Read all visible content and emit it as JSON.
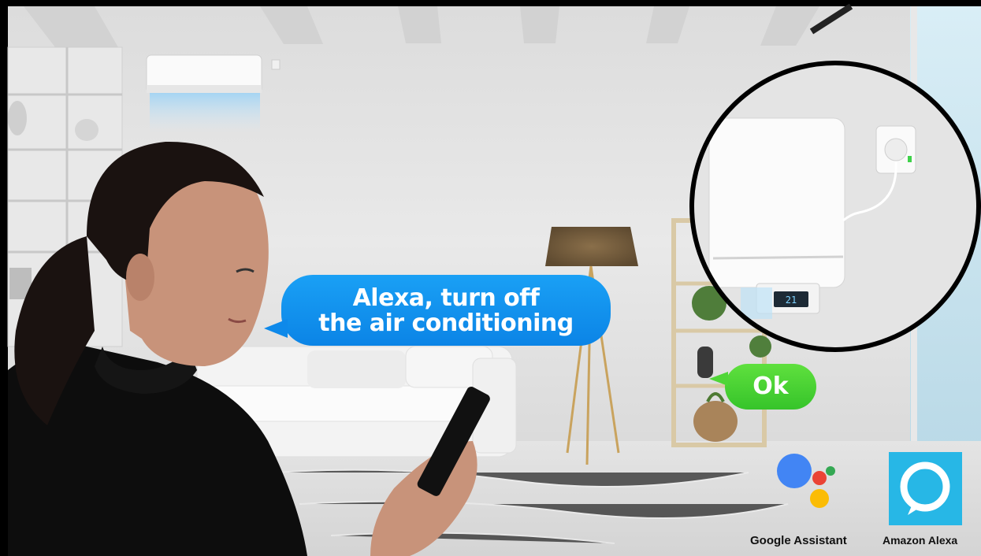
{
  "speech": {
    "user_line1": "Alexa, turn off",
    "user_line2": "the air conditioning",
    "reply": "Ok"
  },
  "assistants": {
    "google_label": "Google Assistant",
    "alexa_label": "Amazon Alexa"
  },
  "display": {
    "ac_temperature": "21"
  },
  "colors": {
    "user_bubble": "#0b84e6",
    "reply_bubble": "#36c42a",
    "alexa_logo_bg": "#27b7e6",
    "google_blue": "#4285f4",
    "google_red": "#ea4335",
    "google_yellow": "#fbbc05",
    "google_green": "#34a853"
  },
  "icons": {
    "google": "google-assistant-icon",
    "alexa": "amazon-alexa-icon"
  }
}
